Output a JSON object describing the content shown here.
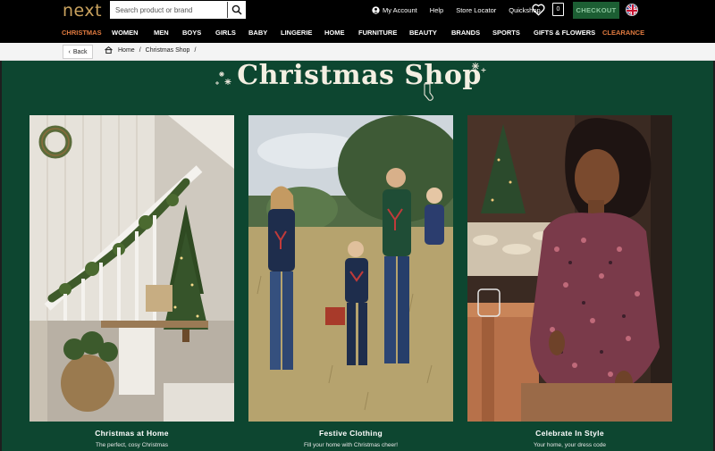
{
  "header": {
    "logo": "next",
    "search": {
      "placeholder": "Search product or brand",
      "icon": "search-icon"
    },
    "links": [
      {
        "label": "My Account",
        "icon": "account-icon"
      },
      {
        "label": "Help"
      },
      {
        "label": "Store Locator"
      },
      {
        "label": "Quickshop"
      }
    ],
    "bag_count": "0",
    "checkout_label": "CHECKOUT",
    "colors": {
      "checkout_bg": "#1c5e33",
      "checkout_text": "#8cc79e",
      "accent": "#e07a3f",
      "logo": "#c9a25e"
    }
  },
  "nav": {
    "items": [
      {
        "label": "CHRISTMAS",
        "accent": true
      },
      {
        "label": "WOMEN"
      },
      {
        "label": "MEN"
      },
      {
        "label": "BOYS"
      },
      {
        "label": "GIRLS"
      },
      {
        "label": "BABY"
      },
      {
        "label": "LINGERIE"
      },
      {
        "label": "HOME"
      },
      {
        "label": "FURNITURE"
      },
      {
        "label": "BEAUTY"
      },
      {
        "label": "BRANDS"
      },
      {
        "label": "SPORTS"
      },
      {
        "label": "GIFTS & FLOWERS"
      },
      {
        "label": "CLEARANCE",
        "accent": true
      }
    ]
  },
  "breadcrumb": {
    "back_label": "Back",
    "items": [
      "Home",
      "Christmas Shop"
    ]
  },
  "page": {
    "title": "Christmas Shop",
    "background": "#0d4630",
    "cards": [
      {
        "title": "Christmas at Home",
        "subtitle": "The perfect, cosy Christmas"
      },
      {
        "title": "Festive Clothing",
        "subtitle": "Fill your home with Christmas cheer!"
      },
      {
        "title": "Celebrate In Style",
        "subtitle": "Your home, your dress code"
      }
    ]
  }
}
